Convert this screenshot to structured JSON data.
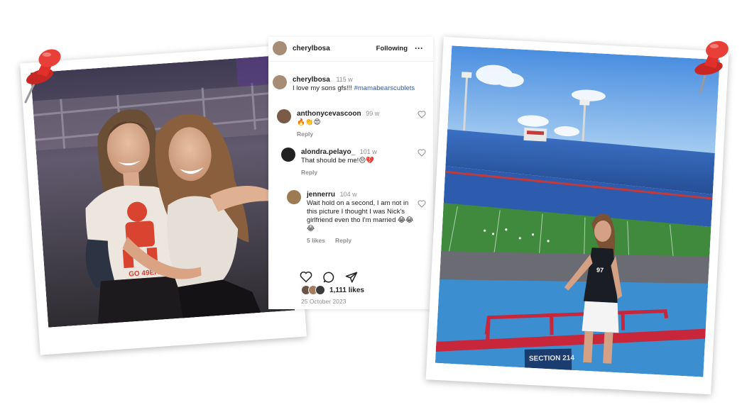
{
  "post": {
    "username": "cherylbosa",
    "follow_status": "Following",
    "more_label": "···",
    "caption": {
      "username": "cherylbosa",
      "time": "115 w",
      "text": "I love my sons gfs!!! ",
      "hashtag": "#mamabearscublets"
    },
    "comments": [
      {
        "username": "anthonycevascoon",
        "time": "99 w",
        "text": "🔥👏😍",
        "reply": "Reply",
        "likes": ""
      },
      {
        "username": "alondra.pelayo_",
        "time": "101 w",
        "text": "That should be me!😔💔",
        "reply": "Reply",
        "likes": ""
      },
      {
        "username": "jennerru",
        "time": "104 w",
        "text": "Wait hold on a second, I am not in this picture I thought I was Nick's girlfriend even tho I'm married 😂😂😂",
        "reply": "Reply",
        "likes": "5 likes"
      }
    ],
    "likes": "1,111 likes",
    "date": "25 October 2023"
  },
  "photos": {
    "left": {
      "shirt_text": "GO 49ERS"
    },
    "right": {
      "section_sign": "SECTION 214",
      "shirt_number": "97"
    }
  },
  "colors": {
    "pin_red": "#e0302b",
    "hashtag_blue": "#3a5a98",
    "stadium_blue": "#2f66b8",
    "field_green": "#3f8a3c"
  },
  "icons": [
    "push-pin-icon",
    "heart-icon",
    "comment-icon",
    "share-icon",
    "more-icon"
  ]
}
